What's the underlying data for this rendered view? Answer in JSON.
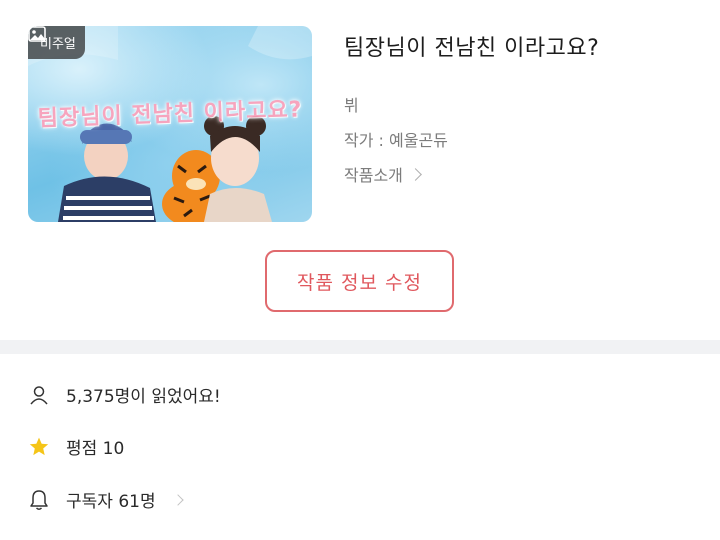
{
  "work": {
    "title": "팀장님이 전남친 이라고요?",
    "cover_badge": "비주얼",
    "cover_title": "팀장님이 전남친 이라고요?",
    "genre": "뷔",
    "author": "작가 : 예울곤듀",
    "intro_label": "작품소개"
  },
  "actions": {
    "edit_label": "작품 정보 수정"
  },
  "stats": {
    "reads": "5,375명이 읽었어요!",
    "rating": "평점 10",
    "subscribers": "구독자 61명"
  },
  "icons": {
    "badge": "image-icon",
    "reads": "user-icon",
    "rating": "star-icon",
    "subscribers": "bell-icon",
    "intro": "chevron-right-icon"
  },
  "colors": {
    "accent": "#e0585e",
    "star": "#f5c518",
    "divider": "#f1f2f4"
  }
}
